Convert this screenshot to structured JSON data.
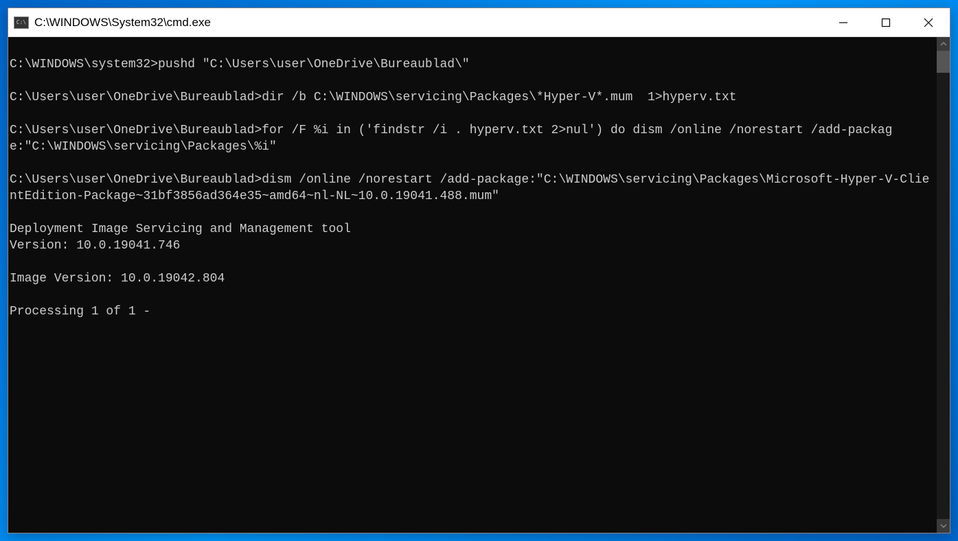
{
  "window": {
    "title": "C:\\WINDOWS\\System32\\cmd.exe"
  },
  "terminal": {
    "lines": [
      "",
      "C:\\WINDOWS\\system32>pushd \"C:\\Users\\user\\OneDrive\\Bureaublad\\\"",
      "",
      "C:\\Users\\user\\OneDrive\\Bureaublad>dir /b C:\\WINDOWS\\servicing\\Packages\\*Hyper-V*.mum  1>hyperv.txt",
      "",
      "C:\\Users\\user\\OneDrive\\Bureaublad>for /F %i in ('findstr /i . hyperv.txt 2>nul') do dism /online /norestart /add-package:\"C:\\WINDOWS\\servicing\\Packages\\%i\"",
      "",
      "C:\\Users\\user\\OneDrive\\Bureaublad>dism /online /norestart /add-package:\"C:\\WINDOWS\\servicing\\Packages\\Microsoft-Hyper-V-ClientEdition-Package~31bf3856ad364e35~amd64~nl-NL~10.0.19041.488.mum\"",
      "",
      "Deployment Image Servicing and Management tool",
      "Version: 10.0.19041.746",
      "",
      "Image Version: 10.0.19042.804",
      "",
      "Processing 1 of 1 -"
    ]
  }
}
